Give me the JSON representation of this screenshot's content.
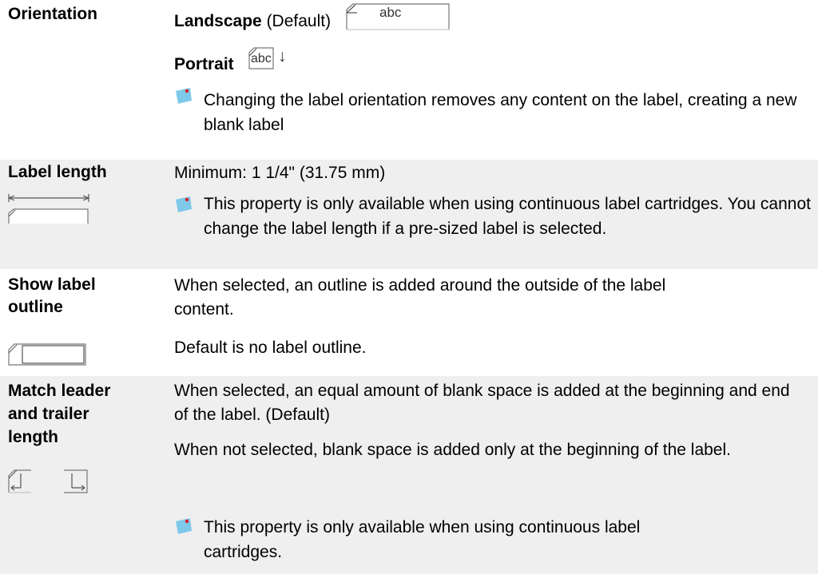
{
  "rows": [
    {
      "property": "Orientation",
      "landscape_label": "Landscape",
      "landscape_suffix": "(Default)",
      "landscape_icon_text": "abc",
      "portrait_label": "Portrait",
      "portrait_icon_text": "abc",
      "portrait_arrow": "↓",
      "note": "Changing the label orientation removes any content on the label, creating a new blank label"
    },
    {
      "property": "Label length",
      "text": "Minimum: 1 1/4\" (31.75 mm)",
      "note": "This property is only available when using continuous label cartridges. You cannot change the label length if a pre-sized label is selected."
    },
    {
      "property": "Show label outline",
      "text1": "When selected, an outline is added around the outside of the label content.",
      "text2": "Default is no label outline."
    },
    {
      "property": "Match leader and trailer length",
      "text1": "When selected, an equal amount of blank space is added at the beginning and end of the label. (Default)",
      "text2": "When not selected, blank space is added only at the beginning of the label.",
      "note": "This property is only available when using continuous label cartridges."
    }
  ],
  "colors": {
    "shade": "#efefef",
    "note_icon_body": "#7ec8ea",
    "note_icon_pin": "#d6202a"
  }
}
